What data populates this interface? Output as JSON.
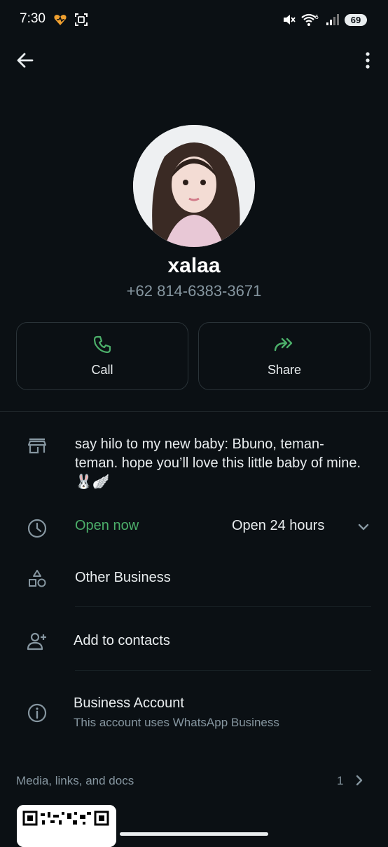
{
  "status": {
    "time": "7:30",
    "battery": "69"
  },
  "contact": {
    "name": "xalaa",
    "phone": "+62 814-6383-3671"
  },
  "actions": {
    "call": "Call",
    "share": "Share"
  },
  "info": {
    "description": "say hilo to my new baby: Bbuno, teman-teman. hope you’ll love this little baby of mine. 🐰🪽",
    "open_status": "Open now",
    "hours": "Open 24 hours",
    "other_business": "Other Business",
    "add_contacts": "Add to contacts",
    "business_account": "Business Account",
    "business_account_sub": "This account uses WhatsApp Business"
  },
  "media": {
    "label": "Media, links, and docs",
    "count": "1"
  },
  "colors": {
    "background": "#0b1014",
    "accent": "#4caf6a",
    "secondary_text": "#8696a0"
  },
  "icons": [
    "back-arrow-icon",
    "more-vert-icon",
    "phone-icon",
    "share-forward-icon",
    "store-icon",
    "clock-icon",
    "shapes-icon",
    "person-add-icon",
    "info-icon",
    "chevron-down-icon",
    "chevron-right-icon"
  ]
}
